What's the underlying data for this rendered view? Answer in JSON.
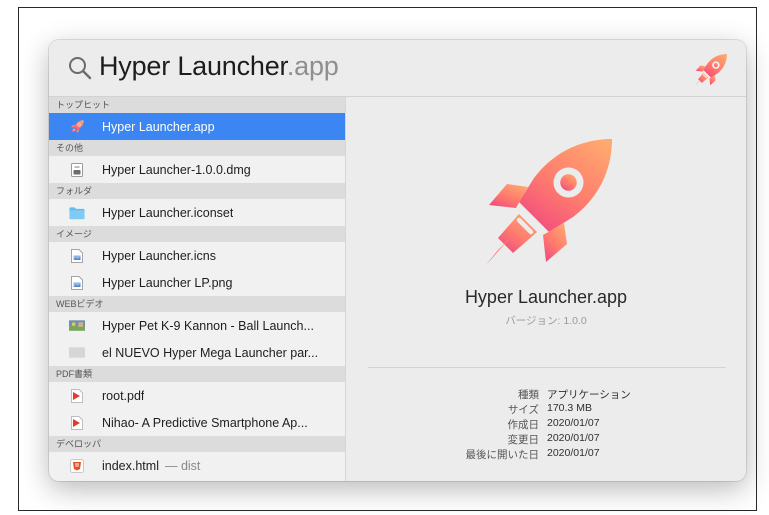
{
  "search": {
    "query": "Hyper Launcher",
    "query_suffix": ".app"
  },
  "sections": [
    {
      "header": "トップヒット",
      "rows": [
        {
          "label": "Hyper Launcher.app",
          "sub": "",
          "icon": "rocket-app-icon",
          "selected": true
        }
      ]
    },
    {
      "header": "その他",
      "rows": [
        {
          "label": "Hyper Launcher-1.0.0.dmg",
          "sub": "",
          "icon": "disk-image-icon",
          "selected": false
        }
      ]
    },
    {
      "header": "フォルダ",
      "rows": [
        {
          "label": "Hyper Launcher.iconset",
          "sub": "",
          "icon": "folder-icon",
          "selected": false
        }
      ]
    },
    {
      "header": "イメージ",
      "rows": [
        {
          "label": "Hyper Launcher.icns",
          "sub": "",
          "icon": "image-file-icon",
          "selected": false
        },
        {
          "label": "Hyper Launcher LP.png",
          "sub": "",
          "icon": "image-file-icon",
          "selected": false
        }
      ]
    },
    {
      "header": "WEBビデオ",
      "rows": [
        {
          "label": "Hyper Pet K-9 Kannon - Ball Launch...",
          "sub": "",
          "icon": "video-thumbnail-icon",
          "selected": false
        },
        {
          "label": "el NUEVO Hyper Mega Launcher par...",
          "sub": "",
          "icon": "video-placeholder-icon",
          "selected": false
        }
      ]
    },
    {
      "header": "PDF書類",
      "rows": [
        {
          "label": "root.pdf",
          "sub": "",
          "icon": "pdf-icon",
          "selected": false
        },
        {
          "label": "Nihao- A Predictive Smartphone Ap...",
          "sub": "",
          "icon": "pdf-icon",
          "selected": false
        }
      ]
    },
    {
      "header": "デベロッパ",
      "rows": [
        {
          "label": "index.html",
          "sub": "— dist",
          "icon": "html-file-icon",
          "selected": false
        }
      ]
    }
  ],
  "preview": {
    "title": "Hyper Launcher.app",
    "version": "バージョン: 1.0.0",
    "meta": [
      {
        "key": "種類",
        "value": "アプリケーション"
      },
      {
        "key": "サイズ",
        "value": "170.3 MB"
      },
      {
        "key": "作成日",
        "value": "2020/01/07"
      },
      {
        "key": "変更日",
        "value": "2020/01/07"
      },
      {
        "key": "最後に開いた日",
        "value": "2020/01/07"
      }
    ]
  },
  "colors": {
    "selection": "#3b86f2",
    "rocket_gradient_top": "#ff9a76",
    "rocket_gradient_bottom": "#f0507a"
  }
}
